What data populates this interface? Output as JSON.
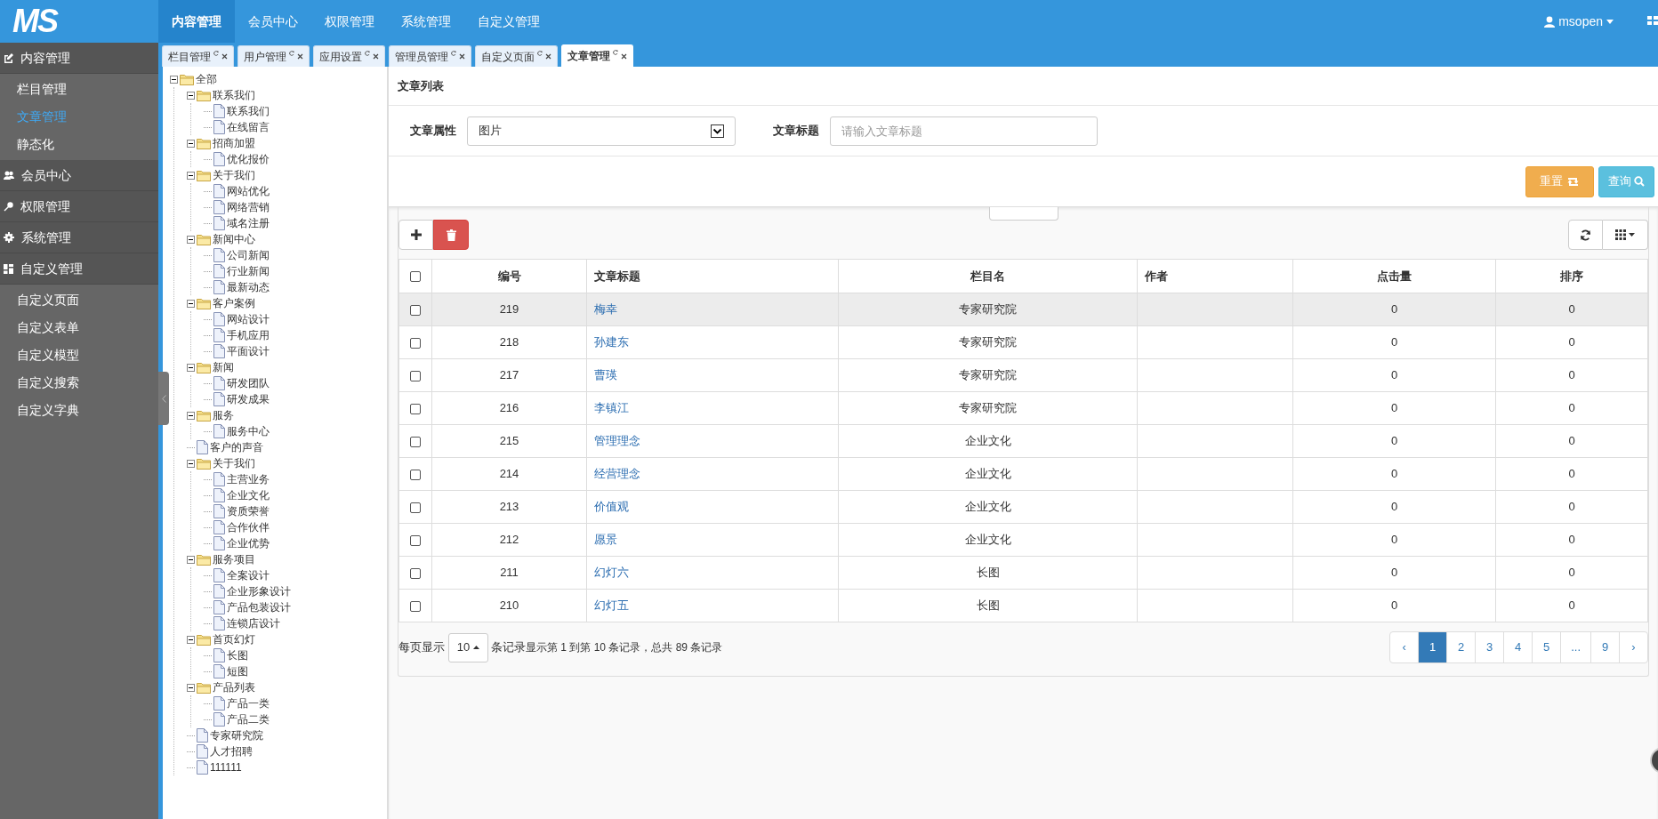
{
  "logo": "MS",
  "top_nav": [
    {
      "label": "内容管理",
      "selected": true
    },
    {
      "label": "会员中心",
      "selected": false
    },
    {
      "label": "权限管理",
      "selected": false
    },
    {
      "label": "系统管理",
      "selected": false
    },
    {
      "label": "自定义管理",
      "selected": false
    }
  ],
  "user": {
    "name": "msopen"
  },
  "sidebar": {
    "groups": [
      {
        "label": "内容管理",
        "items": [
          {
            "label": "栏目管理",
            "selected": false
          },
          {
            "label": "文章管理",
            "selected": true
          },
          {
            "label": "静态化",
            "selected": false
          }
        ]
      },
      {
        "label": "会员中心"
      },
      {
        "label": "权限管理"
      },
      {
        "label": "系统管理"
      },
      {
        "label": "自定义管理",
        "items": [
          {
            "label": "自定义页面",
            "selected": false
          },
          {
            "label": "自定义表单",
            "selected": false
          },
          {
            "label": "自定义模型",
            "selected": false
          },
          {
            "label": "自定义搜索",
            "selected": false
          },
          {
            "label": "自定义字典",
            "selected": false
          }
        ]
      }
    ]
  },
  "tabs": [
    {
      "label": "栏目管理",
      "selected": false
    },
    {
      "label": "用户管理",
      "selected": false
    },
    {
      "label": "应用设置",
      "selected": false
    },
    {
      "label": "管理员管理",
      "selected": false
    },
    {
      "label": "自定义页面",
      "selected": false
    },
    {
      "label": "文章管理",
      "selected": true
    }
  ],
  "tree": [
    {
      "label": "全部",
      "expanded": true,
      "children": [
        {
          "label": "联系我们",
          "expanded": true,
          "children": [
            {
              "label": "联系我们"
            },
            {
              "label": "在线留言"
            }
          ]
        },
        {
          "label": "招商加盟",
          "expanded": true,
          "children": [
            {
              "label": "优化报价"
            }
          ]
        },
        {
          "label": "关于我们",
          "expanded": true,
          "children": [
            {
              "label": "网站优化"
            },
            {
              "label": "网络营销"
            },
            {
              "label": "域名注册"
            }
          ]
        },
        {
          "label": "新闻中心",
          "expanded": true,
          "children": [
            {
              "label": "公司新闻"
            },
            {
              "label": "行业新闻"
            },
            {
              "label": "最新动态"
            }
          ]
        },
        {
          "label": "客户案例",
          "expanded": true,
          "children": [
            {
              "label": "网站设计"
            },
            {
              "label": "手机应用"
            },
            {
              "label": "平面设计"
            }
          ]
        },
        {
          "label": "新闻",
          "expanded": true,
          "children": [
            {
              "label": "研发团队"
            },
            {
              "label": "研发成果"
            }
          ]
        },
        {
          "label": "服务",
          "expanded": true,
          "children": [
            {
              "label": "服务中心"
            }
          ]
        },
        {
          "label": "客户的声音"
        },
        {
          "label": "关于我们",
          "expanded": true,
          "children": [
            {
              "label": "主营业务"
            },
            {
              "label": "企业文化"
            },
            {
              "label": "资质荣誉"
            },
            {
              "label": "合作伙伴"
            },
            {
              "label": "企业优势"
            }
          ]
        },
        {
          "label": "服务项目",
          "expanded": true,
          "children": [
            {
              "label": "全案设计"
            },
            {
              "label": "企业形象设计"
            },
            {
              "label": "产品包装设计"
            },
            {
              "label": "连锁店设计"
            }
          ]
        },
        {
          "label": "首页幻灯",
          "expanded": true,
          "children": [
            {
              "label": "长图"
            },
            {
              "label": "短图"
            }
          ]
        },
        {
          "label": "产品列表",
          "expanded": true,
          "children": [
            {
              "label": "产品一类"
            },
            {
              "label": "产品二类"
            }
          ]
        },
        {
          "label": "专家研究院"
        },
        {
          "label": "人才招聘"
        },
        {
          "label": "111111"
        }
      ]
    }
  ],
  "panel_title": "文章列表",
  "filters": [
    {
      "label": "文章属性",
      "kind": "select",
      "value": "图片"
    },
    {
      "label": "文章标题",
      "kind": "text",
      "placeholder": "请输入文章标题"
    }
  ],
  "actions": [
    {
      "label": "重置",
      "kind": "reset"
    },
    {
      "label": "查询",
      "kind": "search"
    }
  ],
  "table": {
    "all_checked": false,
    "columns": [
      "",
      "编号",
      "文章标题",
      "栏目名",
      "作者",
      "点击量",
      "排序"
    ],
    "rows": [
      {
        "id": "219",
        "title": "梅幸",
        "category": "专家研究院",
        "clicks": "0",
        "sort": "0",
        "checked": false,
        "hovered": true
      },
      {
        "id": "218",
        "title": "孙建东",
        "category": "专家研究院",
        "clicks": "0",
        "sort": "0",
        "checked": false,
        "hovered": false
      },
      {
        "id": "217",
        "title": "曹瑛",
        "category": "专家研究院",
        "clicks": "0",
        "sort": "0",
        "checked": false,
        "hovered": false
      },
      {
        "id": "216",
        "title": "李镇江",
        "category": "专家研究院",
        "clicks": "0",
        "sort": "0",
        "checked": false,
        "hovered": false
      },
      {
        "id": "215",
        "title": "管理理念",
        "category": "企业文化",
        "clicks": "0",
        "sort": "0",
        "checked": false,
        "hovered": false
      },
      {
        "id": "214",
        "title": "经营理念",
        "category": "企业文化",
        "clicks": "0",
        "sort": "0",
        "checked": false,
        "hovered": false
      },
      {
        "id": "213",
        "title": "价值观",
        "category": "企业文化",
        "clicks": "0",
        "sort": "0",
        "checked": false,
        "hovered": false
      },
      {
        "id": "212",
        "title": "愿景",
        "category": "企业文化",
        "clicks": "0",
        "sort": "0",
        "checked": false,
        "hovered": false
      },
      {
        "id": "211",
        "title": "幻灯六",
        "category": "长图",
        "clicks": "0",
        "sort": "0",
        "checked": false,
        "hovered": false
      },
      {
        "id": "210",
        "title": "幻灯五",
        "category": "长图",
        "clicks": "0",
        "sort": "0",
        "checked": false,
        "hovered": false
      }
    ]
  },
  "pagination": {
    "per_page_label": "每页显示",
    "per_page": "10",
    "records_label": "条记录",
    "summary": "显示第 1 到第 10 条记录，总共 89 条记录",
    "pages": [
      {
        "label": "‹",
        "selected": false
      },
      {
        "label": "1",
        "selected": true
      },
      {
        "label": "2",
        "selected": false
      },
      {
        "label": "3",
        "selected": false
      },
      {
        "label": "4",
        "selected": false
      },
      {
        "label": "5",
        "selected": false
      },
      {
        "label": "...",
        "selected": false
      },
      {
        "label": "9",
        "selected": false
      },
      {
        "label": "›",
        "selected": false
      }
    ]
  }
}
